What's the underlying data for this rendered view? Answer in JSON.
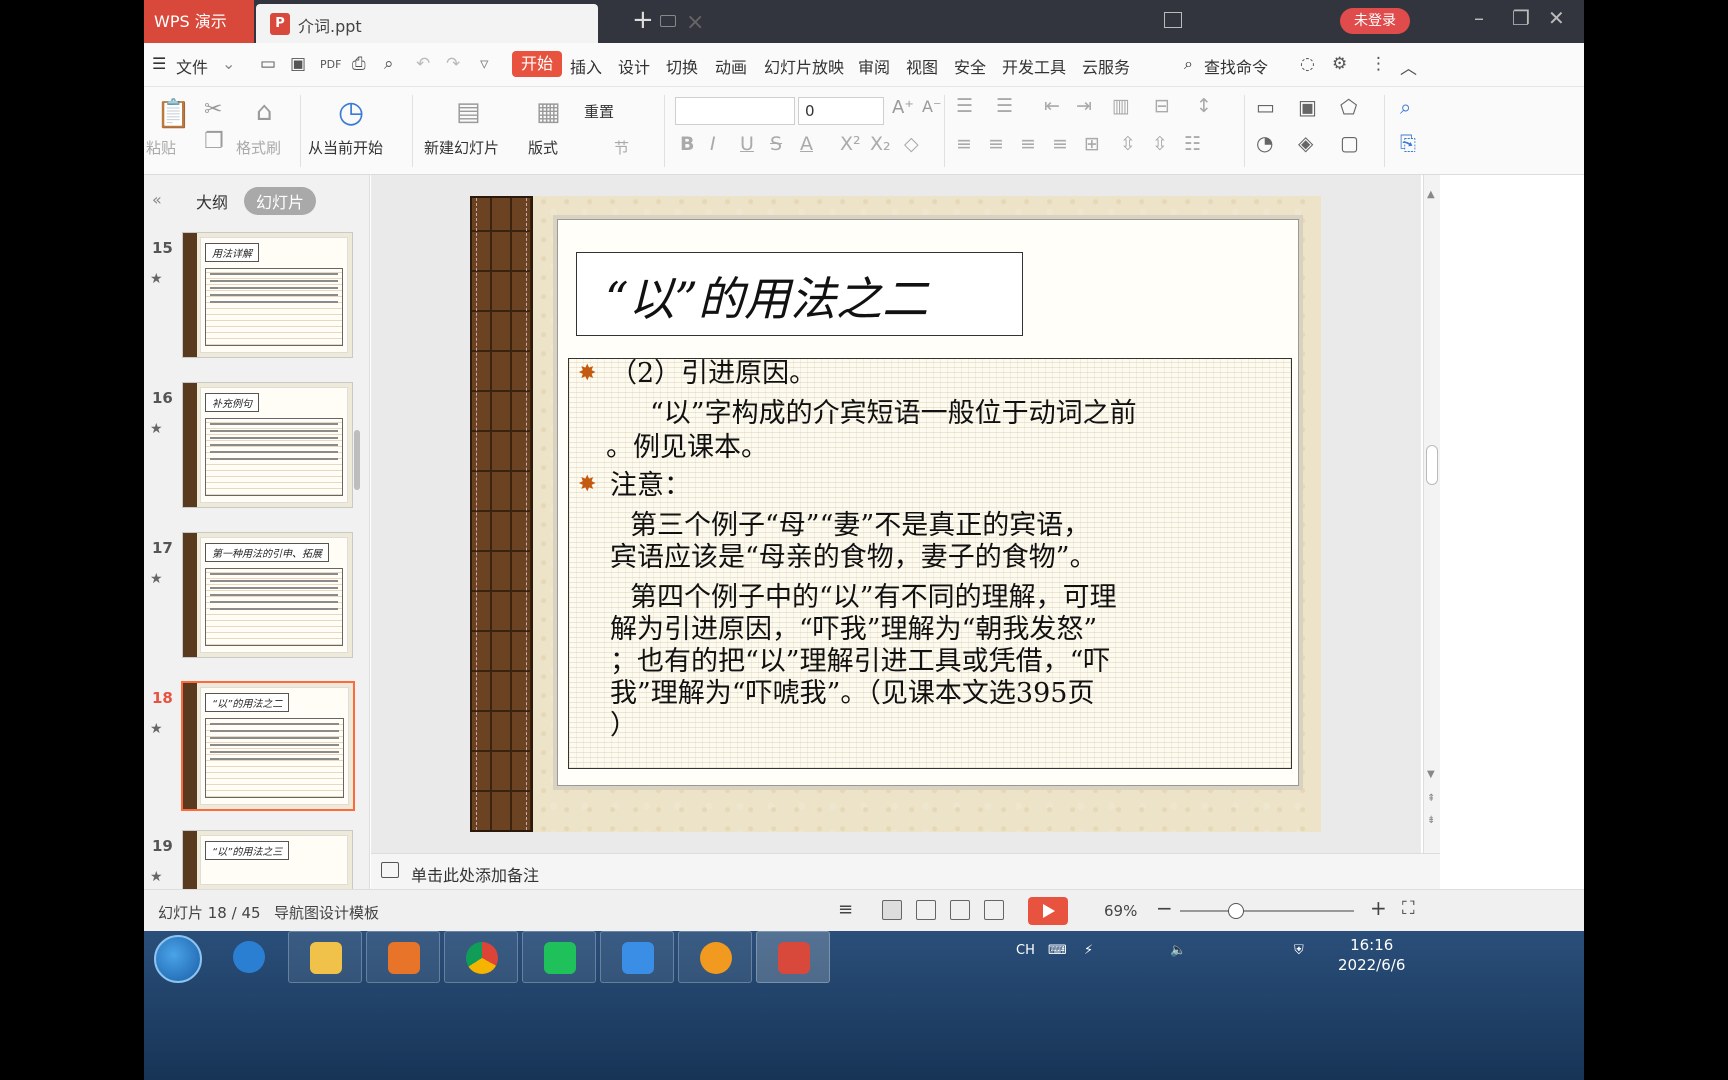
{
  "titlebar": {
    "app_name": "WPS 演示",
    "doc_tab": "介词.ppt",
    "doc_icon_letter": "P",
    "login_label": "未登录"
  },
  "menu": {
    "file": "文件",
    "tabs": [
      "开始",
      "插入",
      "设计",
      "切换",
      "动画",
      "幻灯片放映",
      "审阅",
      "视图",
      "安全",
      "开发工具",
      "云服务"
    ],
    "search": "查找命令"
  },
  "ribbon": {
    "paste": "粘贴",
    "format_painter": "格式刷",
    "from_current": "从当前开始",
    "new_slide": "新建幻灯片",
    "layout": "版式",
    "reset": "重置",
    "section": "节",
    "font_size": "0"
  },
  "panel": {
    "tab_outline": "大纲",
    "tab_slides": "幻灯片",
    "thumbs": [
      {
        "num": "15",
        "title": "用法详解"
      },
      {
        "num": "16",
        "title": "补充例句"
      },
      {
        "num": "17",
        "title": "第一种用法的引申、拓展"
      },
      {
        "num": "18",
        "title": "“以”的用法之二"
      },
      {
        "num": "19",
        "title": "“以”的用法之三"
      }
    ]
  },
  "slide": {
    "title": "“以”的用法之二",
    "lines": [
      "（2）引进原因。",
      "“以”字构成的介宾短语一般位于动词之前",
      "。例见课本。",
      "注意：",
      "第三个例子“母”“妻”不是真正的宾语，",
      "宾语应该是“母亲的食物，妻子的食物”。",
      "第四个例子中的“以”有不同的理解，可理",
      "解为引进原因，“吓我”理解为“朝我发怒”",
      "；也有的把“以”理解引进工具或凭借，“吓",
      "我”理解为“吓唬我”。（见课本文选395页",
      "）"
    ]
  },
  "notes": {
    "placeholder": "单击此处添加备注"
  },
  "status": {
    "slide_count": "幻灯片 18 / 45",
    "template": "导航图设计模板",
    "zoom": "69%"
  },
  "taskbar": {
    "lang": "CH",
    "time": "16:16",
    "date": "2022/6/6"
  }
}
